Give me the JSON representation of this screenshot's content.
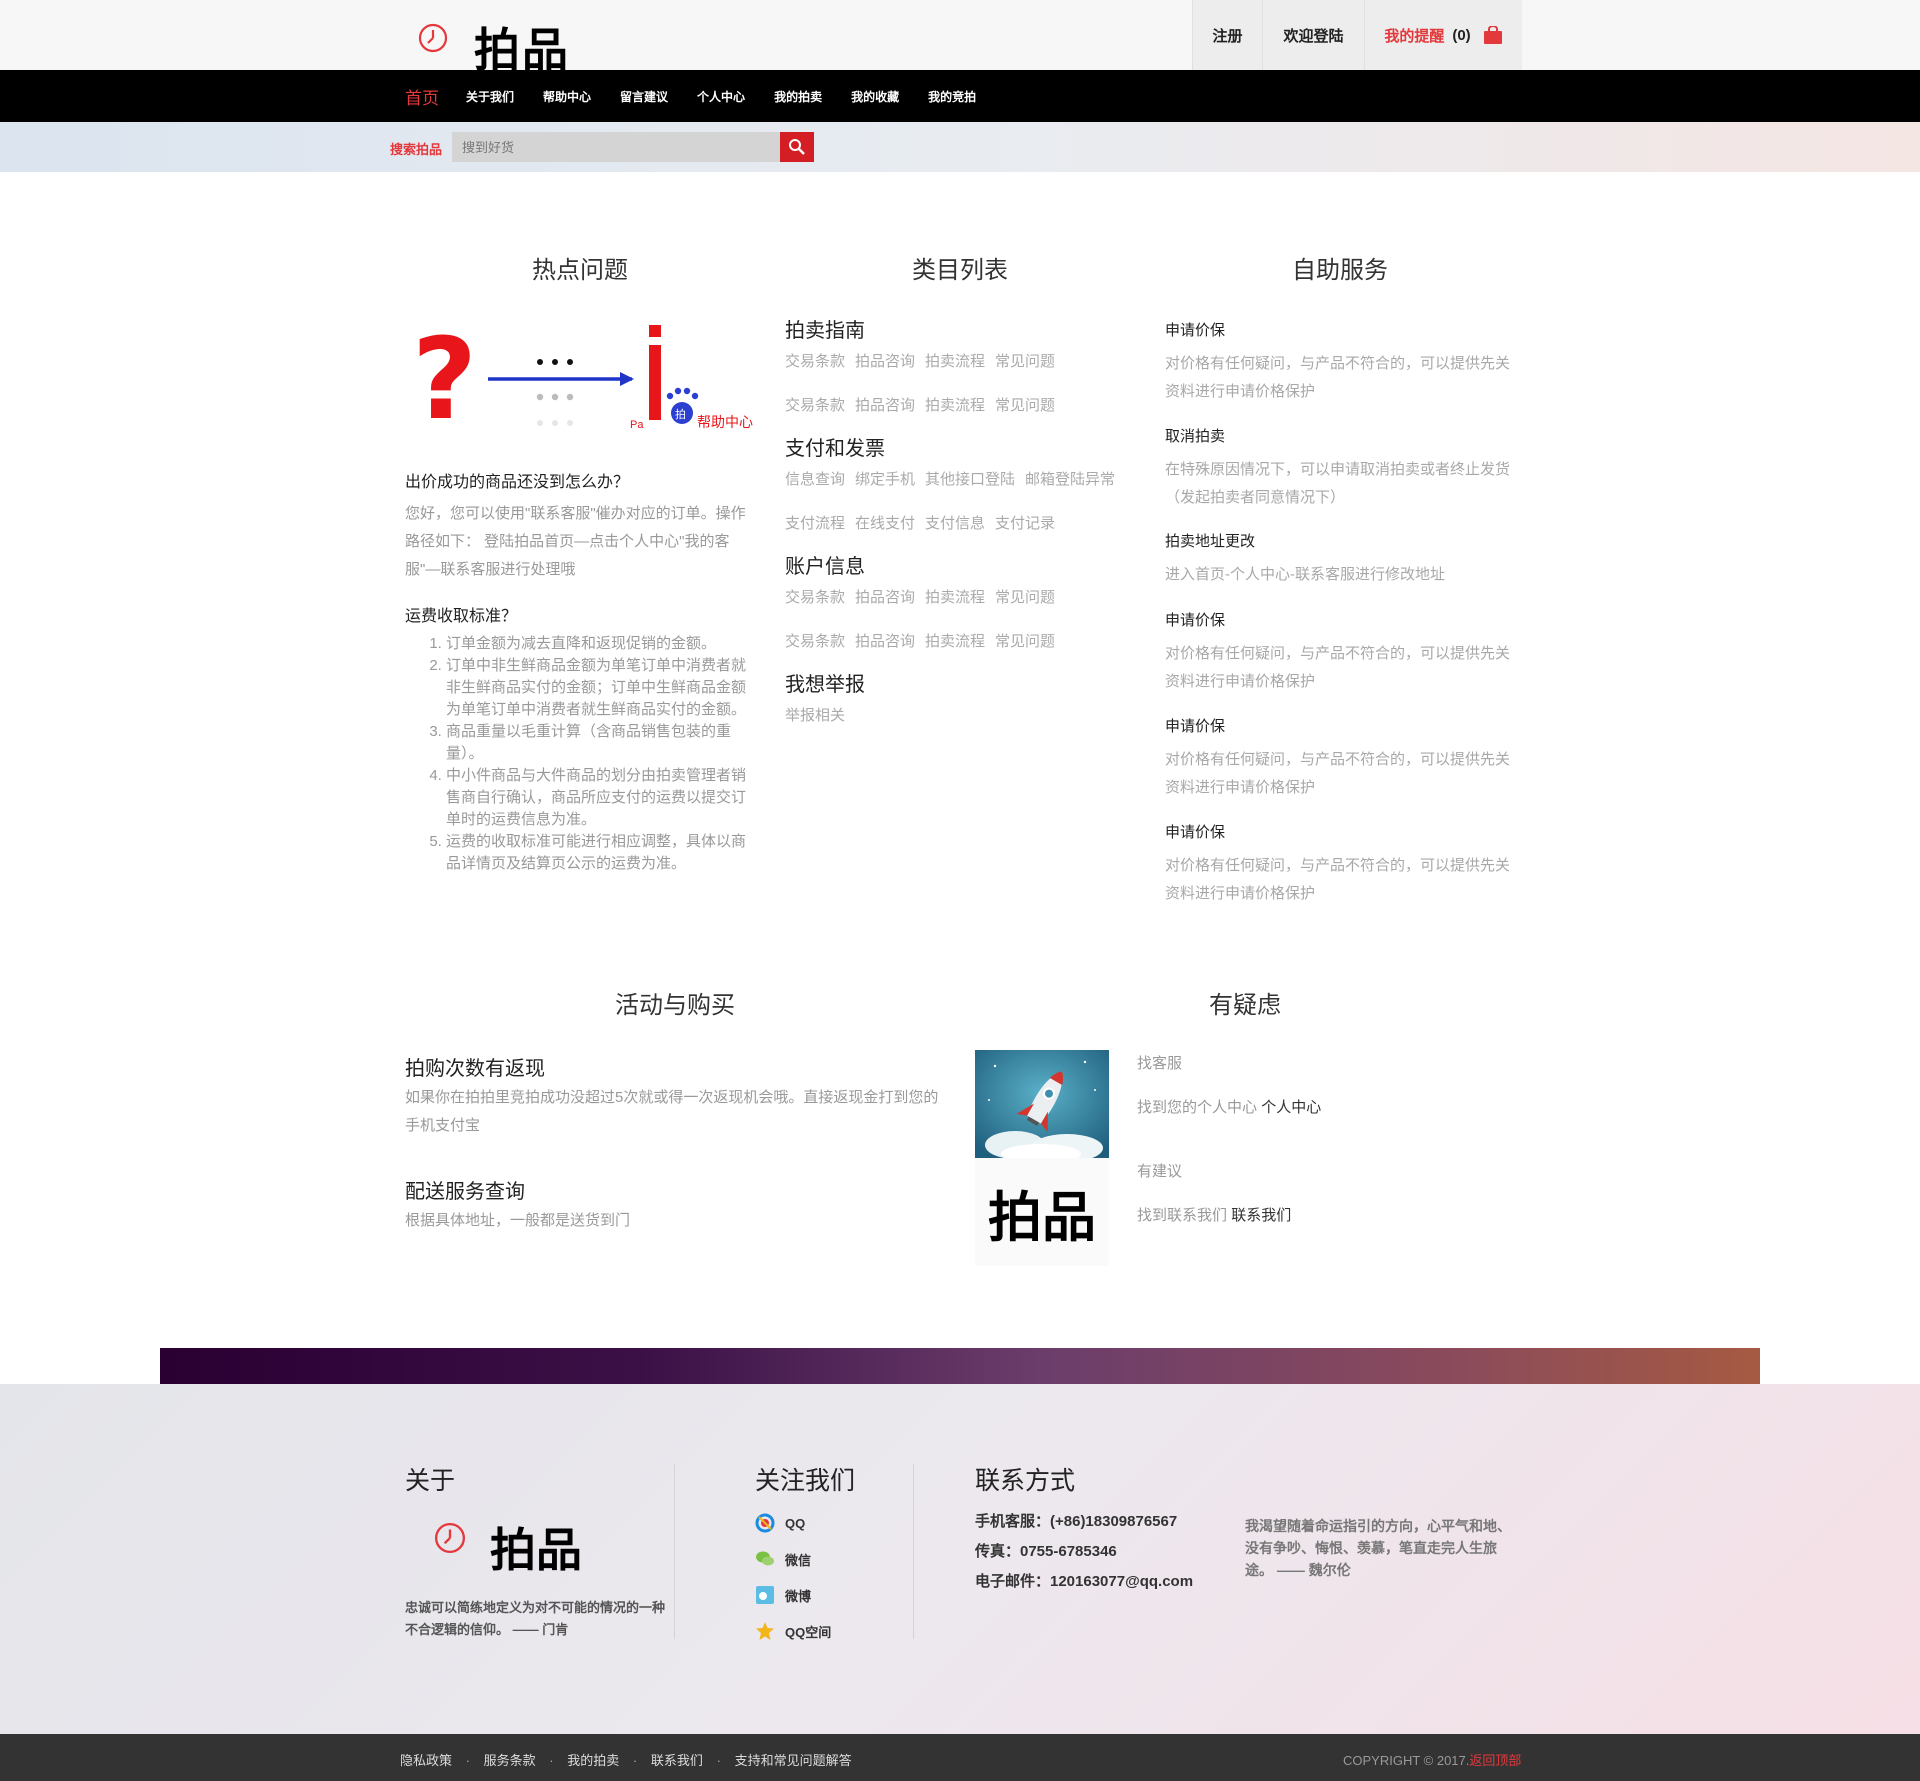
{
  "header": {
    "logo_text": "拍品",
    "register": "注册",
    "login": "欢迎登陆",
    "reminder": "我的提醒",
    "reminder_count": "(0)"
  },
  "nav": {
    "items": [
      "首页",
      "关于我们",
      "帮助中心",
      "留言建议",
      "个人中心",
      "我的拍卖",
      "我的收藏",
      "我的竞拍"
    ]
  },
  "search": {
    "label": "搜索拍品",
    "placeholder": "搜到好货"
  },
  "hot": {
    "title": "热点问题",
    "graphic_pa": "Pa",
    "graphic_paw": "拍",
    "graphic_caption": "帮助中心",
    "q1": "出价成功的商品还没到怎么办？",
    "a1": "您好，您可以使用\"联系客服\"催办对应的订单。操作路径如下： 登陆拍品首页—点击个人中心\"我的客服\"—联系客服进行处理哦",
    "q2": "运费收取标准？",
    "fee_list": [
      "订单金额为减去直降和返现促销的金额。",
      "订单中非生鲜商品金额为单笔订单中消费者就非生鲜商品实付的金额；订单中生鲜商品金额为单笔订单中消费者就生鲜商品实付的金额。",
      "商品重量以毛重计算（含商品销售包装的重量）。",
      "中小件商品与大件商品的划分由拍卖管理者销售商自行确认，商品所应支付的运费以提交订单时的运费信息为准。",
      "运费的收取标准可能进行相应调整，具体以商品详情页及结算页公示的运费为准。"
    ]
  },
  "categories": {
    "title": "类目列表",
    "groups": [
      {
        "name": "拍卖指南",
        "rows": [
          [
            "交易条款",
            "拍品咨询",
            "拍卖流程",
            "常见问题"
          ],
          [
            "交易条款",
            "拍品咨询",
            "拍卖流程",
            "常见问题"
          ]
        ]
      },
      {
        "name": "支付和发票",
        "rows": [
          [
            "信息查询",
            "绑定手机",
            "其他接口登陆",
            "邮箱登陆异常"
          ],
          [
            "支付流程",
            "在线支付",
            "支付信息",
            "支付记录"
          ]
        ]
      },
      {
        "name": "账户信息",
        "rows": [
          [
            "交易条款",
            "拍品咨询",
            "拍卖流程",
            "常见问题"
          ],
          [
            "交易条款",
            "拍品咨询",
            "拍卖流程",
            "常见问题"
          ]
        ]
      },
      {
        "name": "我想举报",
        "rows": [
          [
            "举报相关"
          ]
        ]
      }
    ]
  },
  "self_service": {
    "title": "自助服务",
    "items": [
      {
        "title": "申请价保",
        "text": "对价格有任何疑问，与产品不符合的，可以提供先关资料进行申请价格保护"
      },
      {
        "title": "取消拍卖",
        "text": "在特殊原因情况下，可以申请取消拍卖或者终止发货（发起拍卖者同意情况下）"
      },
      {
        "title": "拍卖地址更改",
        "text": "进入首页-个人中心-联系客服进行修改地址"
      },
      {
        "title": "申请价保",
        "text": "对价格有任何疑问，与产品不符合的，可以提供先关资料进行申请价格保护"
      },
      {
        "title": "申请价保",
        "text": "对价格有任何疑问，与产品不符合的，可以提供先关资料进行申请价格保护"
      },
      {
        "title": "申请价保",
        "text": "对价格有任何疑问，与产品不符合的，可以提供先关资料进行申请价格保护"
      }
    ]
  },
  "activity": {
    "title": "活动与购买",
    "items": [
      {
        "title": "拍购次数有返现",
        "text": "如果你在拍拍里竞拍成功没超过5次就或得一次返现机会哦。直接返现金打到您的手机支付宝"
      },
      {
        "title": "配送服务查询",
        "text": "根据具体地址，一般都是送货到门"
      }
    ]
  },
  "doubt": {
    "title": "有疑虑",
    "logo_text": "拍品",
    "items": [
      {
        "label": "找客服",
        "text": "找到您的个人中心",
        "link": "个人中心"
      },
      {
        "label": "有建议",
        "text": "找到联系我们",
        "link": "联系我们"
      }
    ]
  },
  "footer": {
    "about_title": "关于",
    "logo_text": "拍品",
    "about_quote": "忠诚可以简练地定义为对不可能的情况的一种不合逻辑的信仰。 —— 门肯",
    "follow_title": "关注我们",
    "social": [
      "QQ",
      "微信",
      "微博",
      "QQ空间"
    ],
    "contact_title": "联系方式",
    "phone": "手机客服：(+86)18309876567",
    "fax": "传真：0755-6785346",
    "email": "电子邮件：120163077@qq.com",
    "quote2": "我渴望随着命运指引的方向，心平气和地、没有争吵、悔恨、羡慕，笔直走完人生旅途。 —— 魏尔伦"
  },
  "bottom": {
    "links": [
      "隐私政策",
      "服务条款",
      "我的拍卖",
      "联系我们",
      "支持和常见问题解答"
    ],
    "copyright": "COPYRIGHT © 2017.",
    "back_top": "返回顶部"
  },
  "colors": {
    "accent": "#e4393c",
    "nav_bg": "#000000",
    "footer_bottom": "#333333"
  }
}
